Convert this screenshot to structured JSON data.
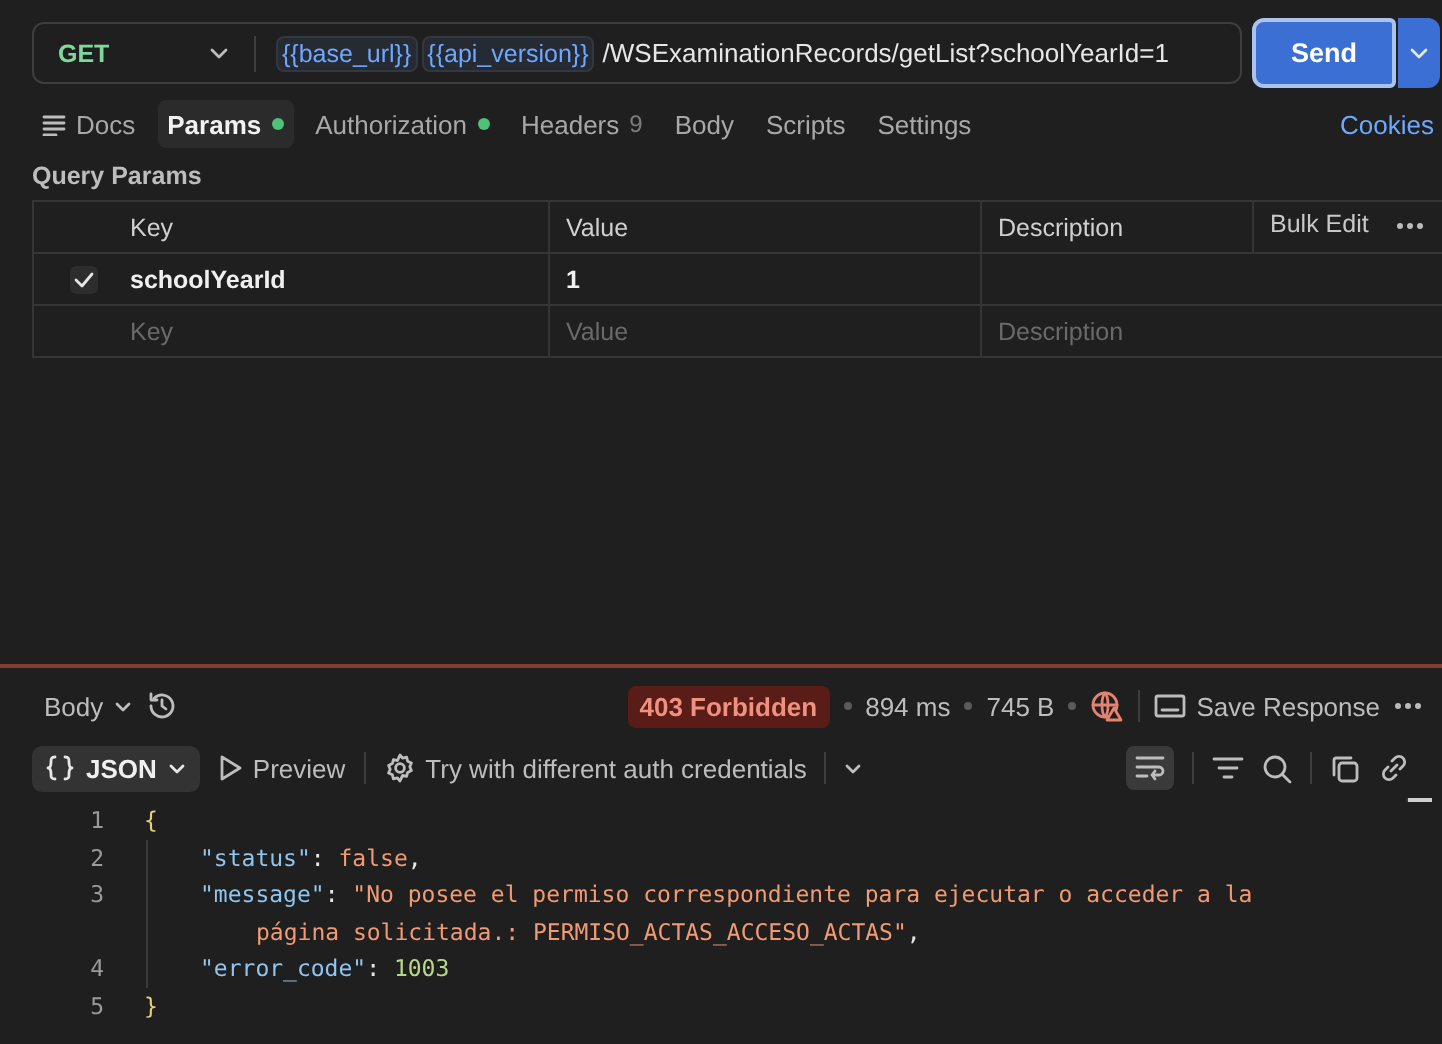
{
  "request": {
    "method": "GET",
    "url_parts": [
      {
        "kind": "variable",
        "text": "{{base_url}}"
      },
      {
        "kind": "variable",
        "text": "{{api_version}}"
      },
      {
        "kind": "path",
        "text": "/WSExaminationRecords/getList?schoolYearId=1"
      }
    ],
    "send": "Send"
  },
  "tabs": [
    {
      "label": "Docs",
      "selected": false,
      "dot": false
    },
    {
      "label": "Params",
      "selected": true,
      "dot": true
    },
    {
      "label": "Authorization",
      "selected": false,
      "dot": true
    },
    {
      "label": "Headers",
      "selected": false,
      "dot": false,
      "count": "9"
    },
    {
      "label": "Body",
      "selected": false,
      "dot": false
    },
    {
      "label": "Scripts",
      "selected": false,
      "dot": false
    },
    {
      "label": "Settings",
      "selected": false,
      "dot": false
    }
  ],
  "cookies": "Cookies",
  "query_params": {
    "title": "Query Params",
    "columns": [
      "Key",
      "Value",
      "Description"
    ],
    "bulk_edit": "Bulk Edit",
    "rows": [
      {
        "checked": true,
        "key": "schoolYearId",
        "value": "1"
      }
    ],
    "new_row": [
      {
        "placeholder": "Key"
      },
      {
        "placeholder": "Value"
      },
      {
        "placeholder": "Description"
      }
    ]
  },
  "response": {
    "body_label": "Body",
    "status": "403 Forbidden",
    "time": "894 ms",
    "size": "745 B",
    "save": "Save Response",
    "format": "JSON",
    "preview": "Preview",
    "auth_hint": "Try with different auth credentials",
    "lines": [
      {
        "kind": "open",
        "number": "1",
        "tokens": [
          {
            "kind": "punct",
            "text": "{"
          }
        ]
      },
      {
        "kind": "member",
        "number": "2",
        "tokens": [
          {
            "kind": "key",
            "text": "\"status\""
          },
          {
            "kind": "punct",
            "text": ": "
          },
          {
            "kind": "literal",
            "text": "false"
          },
          {
            "kind": "punct",
            "text": ","
          }
        ]
      },
      {
        "kind": "member",
        "number": "3",
        "tokens": [
          {
            "kind": "key",
            "text": "\"message\""
          },
          {
            "kind": "punct",
            "text": ": "
          },
          {
            "kind": "string",
            "text": "\"No posee el permiso correspondiente para ejecutar o acceder a la"
          }
        ]
      },
      {
        "kind": "continuation",
        "tokens": [
          {
            "kind": "string",
            "text": "página solicitada.: PERMISO_ACTAS_ACCESO_ACTAS\""
          },
          {
            "kind": "punct",
            "text": ","
          }
        ]
      },
      {
        "kind": "member",
        "number": "4",
        "tokens": [
          {
            "kind": "key",
            "text": "\"error_code\""
          },
          {
            "kind": "punct",
            "text": ": "
          },
          {
            "kind": "number",
            "text": "1003"
          }
        ]
      },
      {
        "kind": "close",
        "number": "5",
        "tokens": [
          {
            "kind": "punct",
            "text": "}"
          }
        ]
      }
    ]
  }
}
